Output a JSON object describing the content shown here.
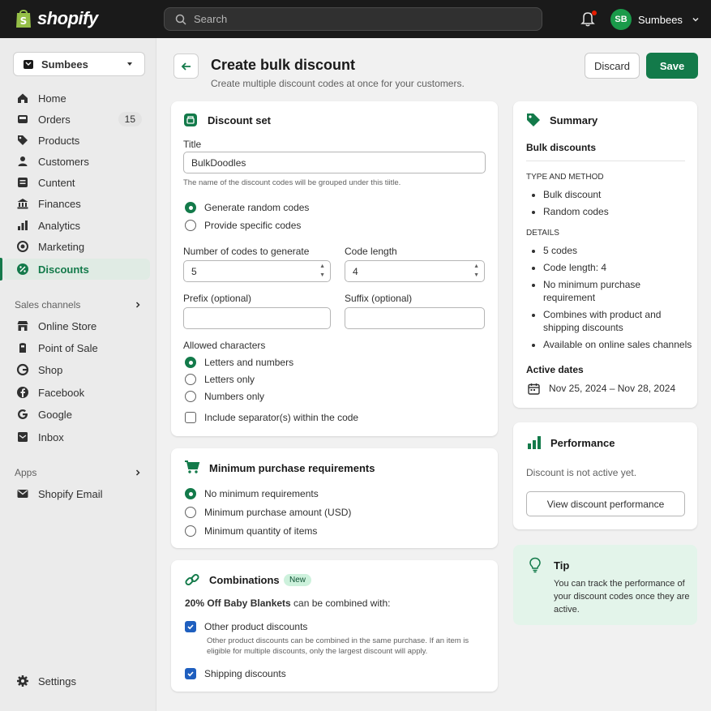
{
  "topbar": {
    "logo_text": "shopify",
    "search_placeholder": "Search",
    "user_initials": "SB",
    "user_name": "Sumbees"
  },
  "sidebar": {
    "store_name": "Sumbees",
    "items": [
      {
        "label": "Home",
        "icon": "home-icon"
      },
      {
        "label": "Orders",
        "icon": "orders-icon",
        "badge": "15"
      },
      {
        "label": "Products",
        "icon": "tag-icon"
      },
      {
        "label": "Customers",
        "icon": "person-icon"
      },
      {
        "label": "Cuntent",
        "icon": "content-icon"
      },
      {
        "label": "Finances",
        "icon": "bank-icon"
      },
      {
        "label": "Analytics",
        "icon": "chart-icon"
      },
      {
        "label": "Marketing",
        "icon": "target-icon"
      },
      {
        "label": "Discounts",
        "icon": "discount-icon"
      }
    ],
    "sales_channels_label": "Sales channels",
    "channels": [
      {
        "label": "Online Store"
      },
      {
        "label": "Point of Sale"
      },
      {
        "label": "Shop"
      },
      {
        "label": "Facebook"
      },
      {
        "label": "Google"
      },
      {
        "label": "Inbox"
      }
    ],
    "apps_label": "Apps",
    "apps": [
      {
        "label": "Shopify Email"
      }
    ],
    "settings_label": "Settings"
  },
  "header": {
    "title": "Create bulk discount",
    "subtitle": "Create multiple discount codes at once for your customers.",
    "discard_label": "Discard",
    "save_label": "Save"
  },
  "discount_set": {
    "title": "Discount set",
    "title_label": "Title",
    "title_value": "BulkDoodles",
    "title_help": "The name of the discount codes will be grouped under this tiitle.",
    "code_options": [
      "Generate random codes",
      "Provide specific codes"
    ],
    "num_codes_label": "Number of codes to generate",
    "num_codes_value": "5",
    "code_length_label": "Code length",
    "code_length_value": "4",
    "prefix_label": "Prefix (optional)",
    "suffix_label": "Suffix (optional)",
    "allowed_label": "Allowed characters",
    "allowed_options": [
      "Letters and numbers",
      "Letters only",
      "Numbers only"
    ],
    "separator_label": "Include separator(s) within the code"
  },
  "min_purchase": {
    "title": "Minimum purchase requirements",
    "options": [
      "No minimum requirements",
      "Minimum purchase amount (USD)",
      "Minimum quantity of items"
    ]
  },
  "combinations": {
    "title": "Combinations",
    "badge": "New",
    "intro_bold": "20% Off Baby Blankets",
    "intro_rest": " can be combined with:",
    "other_label": "Other product discounts",
    "other_help": "Other product discounts can be combined in the same purchase. If an item is eligible for multiple discounts, only the largest discount will apply.",
    "shipping_label": "Shipping discounts"
  },
  "summary": {
    "title": "Summary",
    "subtitle": "Bulk discounts",
    "type_heading": "TYPE AND METHOD",
    "type_items": [
      "Bulk discount",
      "Random codes"
    ],
    "details_heading": "DETAILS",
    "details_items": [
      "5 codes",
      "Code length: 4",
      "No minimum purchase requirement",
      "Combines with product and shipping discounts",
      "Available on online sales channels"
    ],
    "dates_heading": "Active dates",
    "dates_value": "Nov 25, 2024 – Nov 28, 2024"
  },
  "performance": {
    "title": "Performance",
    "status": "Discount is not active yet.",
    "button_label": "View discount performance"
  },
  "tip": {
    "title": "Tip",
    "text": "You can track the performance of your discount codes once they are active."
  }
}
